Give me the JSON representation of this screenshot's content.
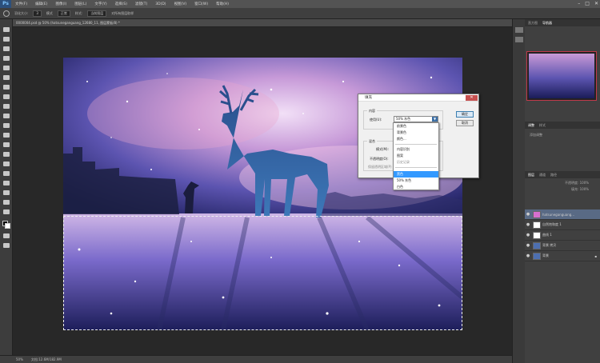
{
  "app": {
    "logo": "Ps"
  },
  "menubar": {
    "items": [
      "文件(F)",
      "编辑(E)",
      "图像(I)",
      "图层(L)",
      "文字(Y)",
      "选择(S)",
      "滤镜(T)",
      "3D(D)",
      "视图(V)",
      "窗口(W)",
      "帮助(H)"
    ]
  },
  "window_controls": {
    "minimize": "–",
    "maximize": "□",
    "close": "✕"
  },
  "options_bar": {
    "feather_label": "羽化大小:",
    "feather_value": "3",
    "mode_label": "模式",
    "mode_value": "正常",
    "style_label": "样式:",
    "style_value": "当前图层",
    "sample_all_label": "对所有图层取样"
  },
  "document": {
    "tab_title": "0000004.psd @ 50% (hatsuneganguang_12680_11, 图层蒙板/8) *"
  },
  "status": {
    "zoom": "50%",
    "doc_size": "文档:12.6M/182.9M"
  },
  "right_panels": {
    "top_tabs": [
      "直方图",
      "导航器"
    ],
    "mid_tabs": [
      "调整",
      "样式"
    ],
    "mid_label": "添加调整",
    "layer_tabs": [
      "图层",
      "通道",
      "路径"
    ],
    "opacity_label": "不透明度:",
    "opacity_value": "100%",
    "fill_label": "填充:",
    "fill_value": "100%"
  },
  "layers": [
    {
      "name": "hatsuneganguang..."
    },
    {
      "name": "自然饱和度 1"
    },
    {
      "name": "曲线 1"
    },
    {
      "name": "背景 拷贝"
    },
    {
      "name": "背景"
    }
  ],
  "fill_dialog": {
    "title": "填充",
    "close": "✕",
    "contents_legend": "内容",
    "use_label": "使用(U):",
    "use_value": "50% 灰色",
    "ok_label": "确定",
    "cancel_label": "取消",
    "blend_legend": "混合",
    "mode_label": "模式(M):",
    "opacity_label": "不透明度(O):",
    "preserve_label": "保留透明区域(P)"
  },
  "use_dropdown": {
    "options": [
      "前景色",
      "背景色",
      "颜色...",
      "内容识别",
      "图案",
      "历史记录",
      "黑色",
      "50% 灰色",
      "白色"
    ],
    "selected_index": 6
  },
  "colors": {
    "accent_red": "#c0394b",
    "selection_blue": "#3399ff"
  }
}
